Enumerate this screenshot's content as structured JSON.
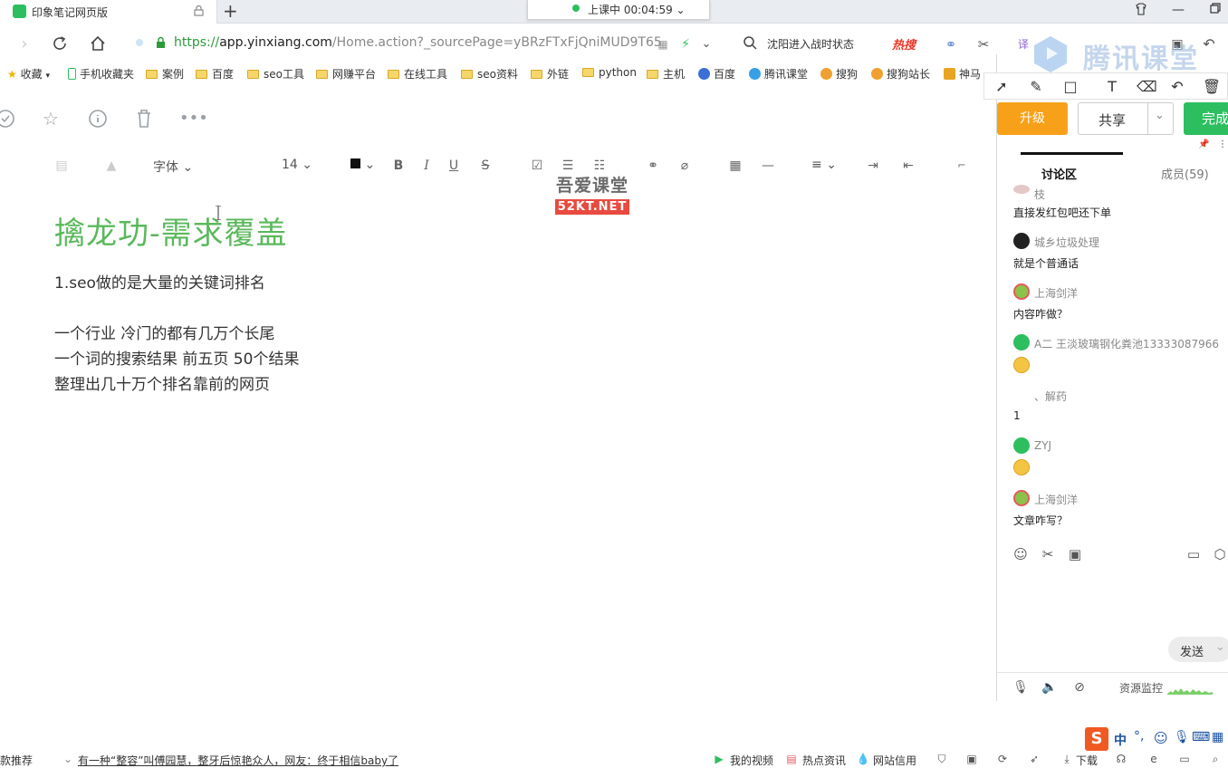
{
  "browser": {
    "tab_title": "印象笔记网页版",
    "new_tab": "+",
    "live_status": "上课中 00:04:59",
    "url_scheme": "https://",
    "url_host": "app.yinxiang.com",
    "url_path": "/Home.action?_sourcePage=yBRzFTxFjQniMUD9T65",
    "hot_search": "沈阳进入战时状态",
    "hot_brand": "热搜"
  },
  "bookmarks": [
    {
      "label": "收藏",
      "icon": "star-icon"
    },
    {
      "label": "手机收藏夹",
      "icon": "phone-icon"
    },
    {
      "label": "案例",
      "icon": "folder-icon"
    },
    {
      "label": "百度",
      "icon": "folder-icon"
    },
    {
      "label": "seo工具",
      "icon": "folder-icon"
    },
    {
      "label": "网赚平台",
      "icon": "folder-icon"
    },
    {
      "label": "在线工具",
      "icon": "folder-icon"
    },
    {
      "label": "seo资料",
      "icon": "folder-icon"
    },
    {
      "label": "外链",
      "icon": "folder-icon"
    },
    {
      "label": "python",
      "icon": "folder-icon"
    },
    {
      "label": "主机",
      "icon": "folder-icon"
    },
    {
      "label": "百度",
      "icon": "baidu-icon"
    },
    {
      "label": "腾讯课堂",
      "icon": "tencent-classroom-icon"
    },
    {
      "label": "搜狗",
      "icon": "sogou-icon"
    },
    {
      "label": "搜狗站长",
      "icon": "sogou-icon"
    },
    {
      "label": "神马",
      "icon": "shenma-icon"
    }
  ],
  "format_bar": {
    "font_label": "字体",
    "font_size": "14",
    "bold": "B",
    "italic": "I",
    "underline": "U",
    "strike": "S"
  },
  "watermark": {
    "top": "吾爱课堂",
    "bottom": "52KT.NET"
  },
  "note": {
    "title": "擒龙功-需求覆盖",
    "lines": [
      "1.seo做的是大量的关键词排名",
      "一个行业 冷门的都有几万个长尾",
      "一个词的搜索结果 前五页 50个结果",
      "整理出几十万个排名靠前的网页"
    ]
  },
  "side": {
    "brand": "腾讯课堂",
    "upgrade": "升级",
    "share": "共享",
    "done": "完成",
    "tab_discussion": "讨论区",
    "tab_members": "成员(59)",
    "messages": [
      {
        "name": "枝",
        "text": "直接发红包吧还下单"
      },
      {
        "name": "城乡垃圾处理",
        "text": "就是个普通话"
      },
      {
        "name": "上海剑洋",
        "text": "内容咋做？"
      },
      {
        "name": "A二 王淡玻璃钢化粪池13333087966",
        "text": ""
      },
      {
        "name": "、解药",
        "text": "1"
      },
      {
        "name": "ZYJ",
        "text": ""
      },
      {
        "name": "上海剑洋",
        "text": "文章咋写？"
      }
    ],
    "send": "发送",
    "resource_monitor": "资源监控"
  },
  "statusbar": {
    "left": "热款推荐",
    "news": "有一种“整容”叫傅园慧，整牙后惊艳众人，网友：终于相信baby了",
    "my_video": "我的视频",
    "hot_news": "热点资讯",
    "site_credit": "网站信用",
    "download": "下载"
  },
  "colors": {
    "brand_green": "#2dbe60",
    "title_green": "#5bb85c",
    "upgrade_orange": "#f7a11a",
    "watermark_red": "#e94a3f"
  }
}
